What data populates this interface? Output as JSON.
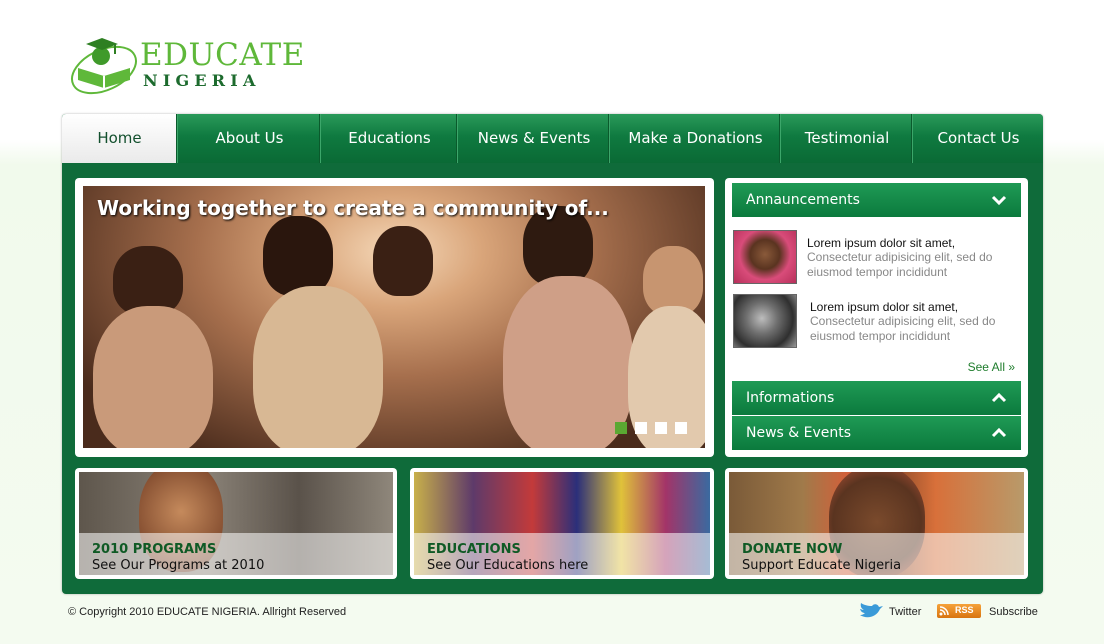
{
  "brand": {
    "line1": "EDUCATE",
    "line2": "NIGERIA"
  },
  "nav": [
    {
      "label": "Home",
      "active": true
    },
    {
      "label": "About Us"
    },
    {
      "label": "Educations"
    },
    {
      "label": "News & Events"
    },
    {
      "label": "Make a Donations"
    },
    {
      "label": "Testimonial"
    },
    {
      "label": "Contact Us"
    }
  ],
  "hero": {
    "caption": "Working together to create a community of...",
    "slides": 4,
    "active_slide": 1
  },
  "sidebar": {
    "announcements_label": "Annauncements",
    "items": [
      {
        "title": "Lorem ipsum dolor sit amet,",
        "body": "Consectetur adipisicing elit, sed do eiusmod tempor incididunt"
      },
      {
        "title": "Lorem ipsum dolor sit amet,",
        "body": "Consectetur adipisicing elit, sed do eiusmod tempor incididunt"
      }
    ],
    "see_all": "See All »",
    "informations_label": "Informations",
    "news_label": "News & Events"
  },
  "tiles": [
    {
      "title": "2010 PROGRAMS",
      "subtitle": "See Our Programs at 2010"
    },
    {
      "title": "EDUCATIONS",
      "subtitle": "See Our Educations here"
    },
    {
      "title": "DONATE NOW",
      "subtitle": "Support Educate Nigeria"
    }
  ],
  "footer": {
    "copyright": "© Copyright 2010 EDUCATE NIGERIA.  Allright Reserved",
    "twitter": "Twitter",
    "rss_badge": "RSS",
    "subscribe": "Subscribe"
  },
  "colors": {
    "primary_green": "#0f6b3a",
    "accent_green": "#5aa832"
  }
}
